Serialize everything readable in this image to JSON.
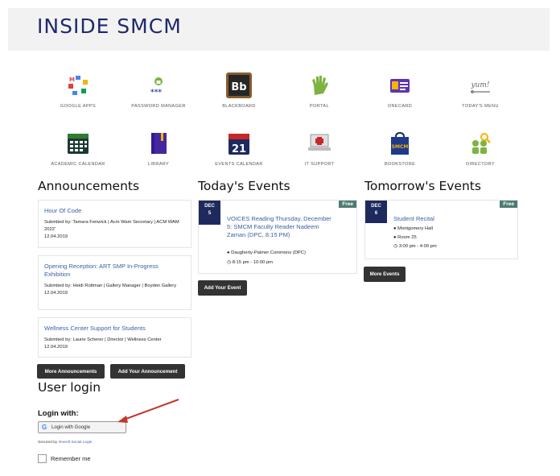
{
  "header": {
    "title": "INSIDE SMCM"
  },
  "apps": [
    {
      "label": "GOOGLE APPS",
      "icon": "google-apps-icon"
    },
    {
      "label": "PASSWORD MANAGER",
      "icon": "password-manager-icon"
    },
    {
      "label": "BLACKBOARD",
      "icon": "blackboard-icon",
      "glyph": "Bb"
    },
    {
      "label": "PORTAL",
      "icon": "portal-hand-icon"
    },
    {
      "label": "ONECARD",
      "icon": "onecard-icon"
    },
    {
      "label": "TODAY'S MENU",
      "icon": "todays-menu-icon",
      "glyph": "yum!"
    },
    {
      "label": "ACADEMIC CALENDAR",
      "icon": "academic-calendar-icon"
    },
    {
      "label": "LIBRARY",
      "icon": "library-book-icon"
    },
    {
      "label": "EVENTS CALENDAR",
      "icon": "events-calendar-icon",
      "glyph": "21"
    },
    {
      "label": "IT SUPPORT",
      "icon": "it-support-icon"
    },
    {
      "label": "BOOKSTORE",
      "icon": "bookstore-icon",
      "glyph": "SMCM"
    },
    {
      "label": "DIRECTORY",
      "icon": "directory-icon"
    }
  ],
  "announcements": {
    "title": "Announcements",
    "items": [
      {
        "title": "Hour Of Code",
        "meta": "Submited by: Tamara Fenwick | Acm Wam Secretary | ACM WAM 2022'",
        "date": "12.04.2019"
      },
      {
        "title": "Opening Reception: ART SMP In-Progress Exhibition",
        "meta": "Submited by: Heidi Rottman | Gallery Manager | Boyden Gallery",
        "date": "12.04.2019"
      },
      {
        "title": "Wellness Center Support for Students",
        "meta": "Submited by: Laurie Scherer | Director | Wellness Center",
        "date": "12.04.2019"
      }
    ],
    "more_label": "More Announcements",
    "add_label": "Add Your Announcement"
  },
  "today": {
    "title": "Today's Events",
    "event": {
      "month": "DEC",
      "day": "5",
      "badge": "Free",
      "title": "VOICES Reading Thursday, December 5: SMCM Faculty Reader Nadeem Zaman (DPC, 8:15 PM)",
      "location": "Daugherty-Palmer Commons (DPC)",
      "time": "8:15 pm - 10:00 pm"
    },
    "add_label": "Add Your Event"
  },
  "tomorrow": {
    "title": "Tomorrow's Events",
    "event": {
      "month": "DEC",
      "day": "6",
      "badge": "Free",
      "title": "Student Recital",
      "location": "Montgomery Hall",
      "room": "Room 25",
      "time": "3:00 pm - 4:00 pm"
    },
    "more_label": "More Events"
  },
  "login": {
    "title": "User login",
    "login_with": "Login with:",
    "google_label": "Login with Google",
    "secured_prefix": "Secured by",
    "secured_link": "OneAll Social Login",
    "remember": "Remember me"
  },
  "colors": {
    "navy": "#1e2a5e",
    "link": "#3a5fa8",
    "free": "#4d7b74",
    "button": "#333333",
    "arrow": "#c0392b"
  }
}
